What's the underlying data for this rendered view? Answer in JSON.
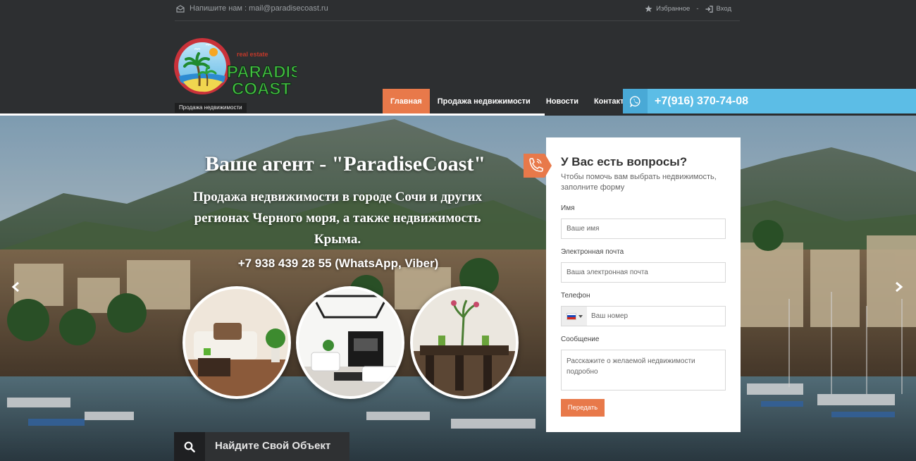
{
  "topbar": {
    "email_text": "Напишите нам : mail@paradisecoast.ru",
    "favorites_label": "Избранное",
    "separator": "-",
    "login_label": "Вход"
  },
  "logo": {
    "small_text": "real estate",
    "line1": "PARADISE",
    "line2": "COAST",
    "tagline": "Продажа недвижимости"
  },
  "nav": {
    "items": [
      {
        "label": "Главная",
        "active": true
      },
      {
        "label": "Продажа недвижимости",
        "active": false
      },
      {
        "label": "Новости",
        "active": false
      },
      {
        "label": "Контакты",
        "active": false
      }
    ],
    "phone": "+7(916) 370-74-08"
  },
  "hero": {
    "title": "Ваше агент - \"ParadiseCoast\"",
    "subtitle": "Продажа недвижимости в городе Сочи и других регионах Черного моря, а также недвижимость Крыма.",
    "phone": "+7 938 439 28 55 (WhatsApp, Viber)",
    "find_label": "Найдите Свой Объект"
  },
  "form": {
    "title": "У Вас есть вопросы?",
    "description": "Чтобы помочь вам выбрать недвижимость, заполните форму",
    "name_label": "Имя",
    "name_placeholder": "Ваше имя",
    "email_label": "Электронная почта",
    "email_placeholder": "Ваша электронная почта",
    "phone_label": "Телефон",
    "phone_placeholder": "Ваш номер",
    "message_label": "Сообщение",
    "message_placeholder": "Расскажите о желаемой недвижимости подробно",
    "submit_label": "Передать"
  },
  "colors": {
    "accent": "#e8794a",
    "phone_bar": "#5cbde6",
    "header_bg": "#2d2f31"
  },
  "icons": [
    "envelope-icon",
    "star-icon",
    "login-icon",
    "whatsapp-icon",
    "phone-icon",
    "search-icon",
    "arrow-left-icon",
    "arrow-right-icon",
    "flag-ru-icon"
  ]
}
